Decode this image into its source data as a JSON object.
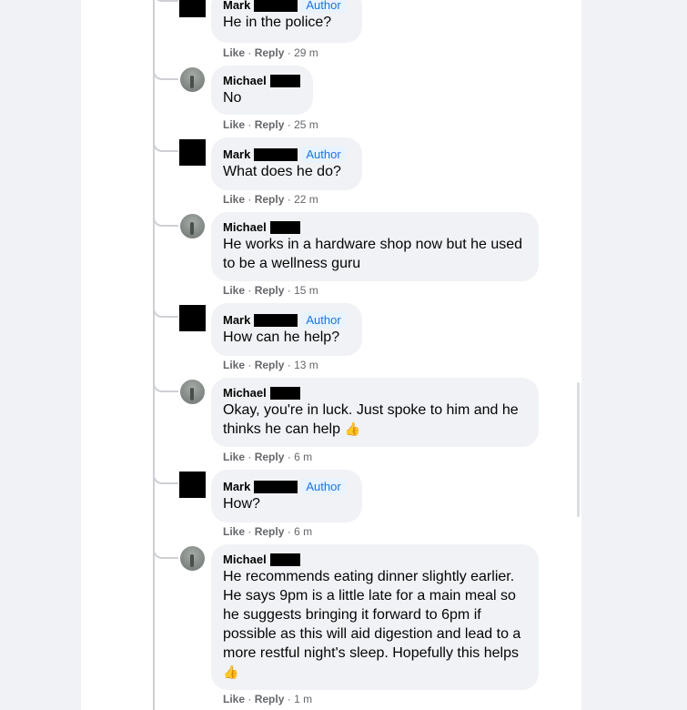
{
  "actions": {
    "like": "Like",
    "reply": "Reply",
    "sep": "·"
  },
  "comments": [
    {
      "name": "Mark",
      "author_badge": "Author",
      "text": "He in the police?",
      "time": "29 m",
      "avatar": "redacted"
    },
    {
      "name": "Michael",
      "author_badge": "",
      "text": "No",
      "time": "25 m",
      "avatar": "photo"
    },
    {
      "name": "Mark",
      "author_badge": "Author",
      "text": "What does he do?",
      "time": "22 m",
      "avatar": "redacted"
    },
    {
      "name": "Michael",
      "author_badge": "",
      "text": "He works in a hardware shop now but he used to be a wellness guru",
      "time": "15 m",
      "avatar": "photo"
    },
    {
      "name": "Mark",
      "author_badge": "Author",
      "text": "How can he help?",
      "time": "13 m",
      "avatar": "redacted"
    },
    {
      "name": "Michael",
      "author_badge": "",
      "text": "Okay, you're in luck. Just spoke to him and he thinks he can help",
      "emoji": "👍",
      "time": "6 m",
      "avatar": "photo"
    },
    {
      "name": "Mark",
      "author_badge": "Author",
      "text": "How?",
      "time": "6 m",
      "avatar": "redacted"
    },
    {
      "name": "Michael",
      "author_badge": "",
      "text": "He recommends eating dinner slightly earlier. He says 9pm is a little late for a main meal so he suggests bringing it forward to 6pm if possible as this will aid digestion and lead to a more restful night's sleep. Hopefully this helps",
      "emoji": "👍",
      "time": "1 m",
      "avatar": "photo"
    }
  ]
}
